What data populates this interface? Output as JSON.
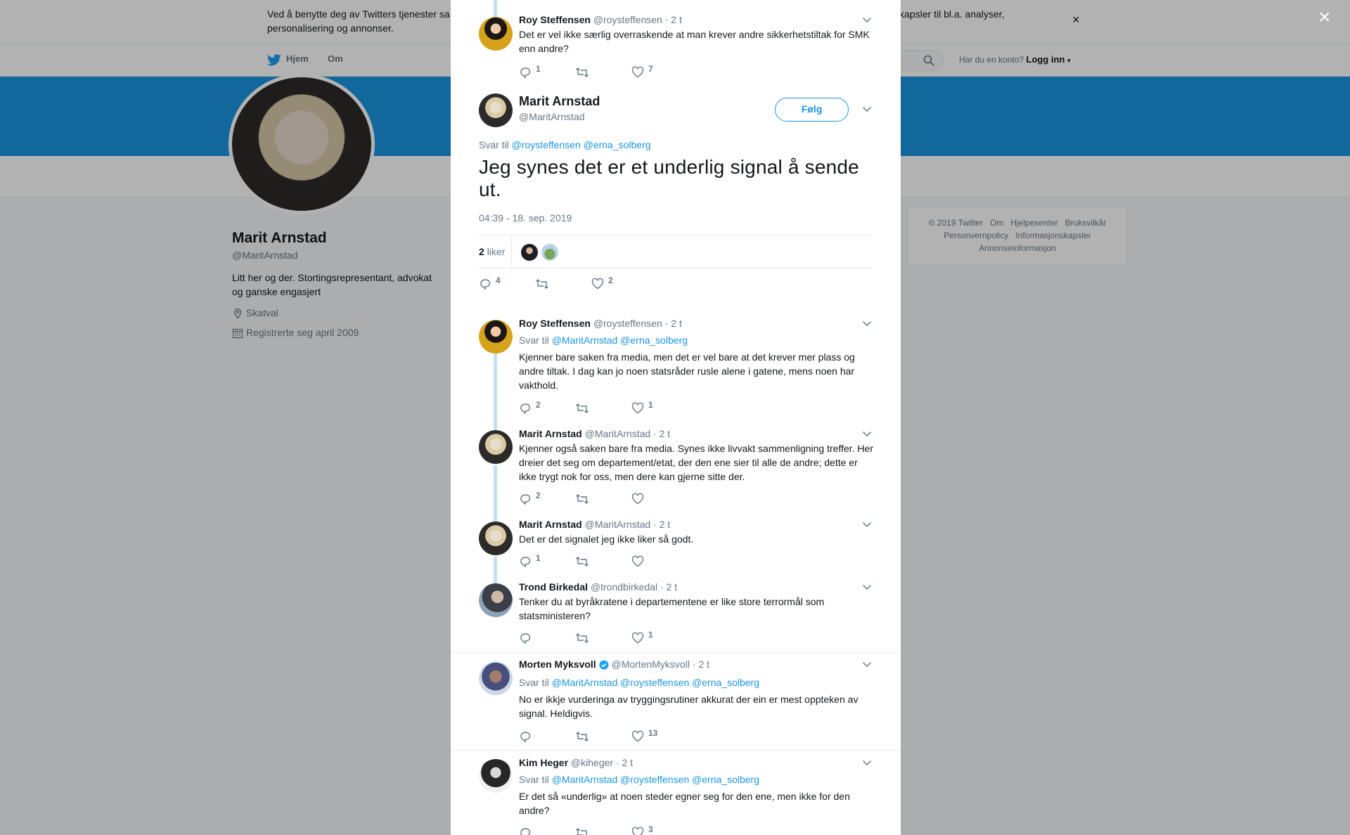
{
  "cookie_banner": {
    "text": "Ved å benytte deg av Twitters tjenester sa… informasjonskapsler til bl.a. analyser, personalisering og annonser.",
    "text_left": "Ved å benytte deg av Twitters tjenester sa",
    "text_right": "informasjonskapsler til bl.a. analyser,",
    "text_line2": "personalisering og annonser.",
    "close": "×"
  },
  "nav": {
    "home": "Hjem",
    "about": "Om",
    "login_question": "Har du en konto?",
    "login": "Logg inn"
  },
  "profile": {
    "name": "Marit Arnstad",
    "handle": "@MaritArnstad",
    "bio": "Litt her og der. Stortingsrepresentant, advokat og ganske engasjert",
    "location": "Skatval",
    "joined": "Registrerte seg april 2009"
  },
  "footer": {
    "links": [
      "© 2019 Twitter",
      "Om",
      "Hjelpesenter",
      "Bruksvilkår",
      "Personvernpolicy",
      "Informasjonskapsler",
      "Annonseinformasjon"
    ]
  },
  "overlay_close": "×",
  "tweets_before": [
    {
      "name": "Roy Steffensen",
      "handle": "@roysteffensen",
      "time": "· 2 t",
      "text": "Det er vel ikke særlig overraskende at man krever andre sikkerhetstiltak for SMK enn andre?",
      "replies": "1",
      "retweets": "",
      "likes": "7"
    }
  ],
  "main_tweet": {
    "name": "Marit Arnstad",
    "handle": "@MaritArnstad",
    "follow": "Følg",
    "reply_prefix": "Svar til",
    "reply_to": [
      "@roysteffensen",
      "@erna_solberg"
    ],
    "text": "Jeg synes det er et underlig signal å sende ut.",
    "timestamp": "04:39 - 18. sep. 2019",
    "like_count": "2",
    "like_label": "liker",
    "replies": "4",
    "retweets": "",
    "likes": "2"
  },
  "replies": [
    {
      "name": "Roy Steffensen",
      "handle": "@roysteffensen",
      "time": "· 2 t",
      "reply_prefix": "Svar til",
      "reply_to": [
        "@MaritArnstad",
        "@erna_solberg"
      ],
      "text": "Kjenner bare saken fra media, men det er vel bare at det krever mer plass og andre tiltak. I dag kan jo noen statsråder rusle alene i gatene, mens noen har vakthold.",
      "replies": "2",
      "retweets": "",
      "likes": "1"
    },
    {
      "name": "Marit Arnstad",
      "handle": "@MaritArnstad",
      "time": "· 2 t",
      "text": "Kjenner også saken bare fra media. Synes ikke livvakt sammenligning treffer. Her dreier det seg om departement/etat,  der den ene sier til alle de andre; dette er ikke trygt nok for oss, men dere kan gjerne sitte der.",
      "replies": "2",
      "retweets": "",
      "likes": ""
    },
    {
      "name": "Marit Arnstad",
      "handle": "@MaritArnstad",
      "time": "· 2 t",
      "text": "Det er det signalet jeg ikke liker så godt.",
      "replies": "1",
      "retweets": "",
      "likes": ""
    },
    {
      "name": "Trond Birkedal",
      "handle": "@trondbirkedal",
      "time": "· 2 t",
      "text": "Tenker du at byråkratene i departementene er like store terrormål som statsministeren?",
      "replies": "",
      "retweets": "",
      "likes": "1"
    },
    {
      "name": "Morten Myksvoll",
      "handle": "@MortenMyksvoll",
      "time": "· 2 t",
      "verified": true,
      "reply_prefix": "Svar til",
      "reply_to": [
        "@MaritArnstad",
        "@roysteffensen",
        "@erna_solberg"
      ],
      "text": "No er ikkje vurderinga av tryggingsrutiner akkurat der ein er mest oppteken av signal. Heldigvis.",
      "replies": "",
      "retweets": "",
      "likes": "13"
    },
    {
      "name": "Kim Heger",
      "handle": "@kiheger",
      "time": "· 2 t",
      "reply_prefix": "Svar til",
      "reply_to": [
        "@MaritArnstad",
        "@roysteffensen",
        "@erna_solberg"
      ],
      "text": "Er det så «underlig» at noen steder egner seg for den ene, men ikke for den andre?",
      "replies": "",
      "retweets": "",
      "likes": "3"
    }
  ],
  "colors": {
    "accent": "#1b95e0",
    "banner": "#1b95e0",
    "text": "#14171a",
    "muted": "#657786",
    "thread_line": "#c4e0f2"
  }
}
